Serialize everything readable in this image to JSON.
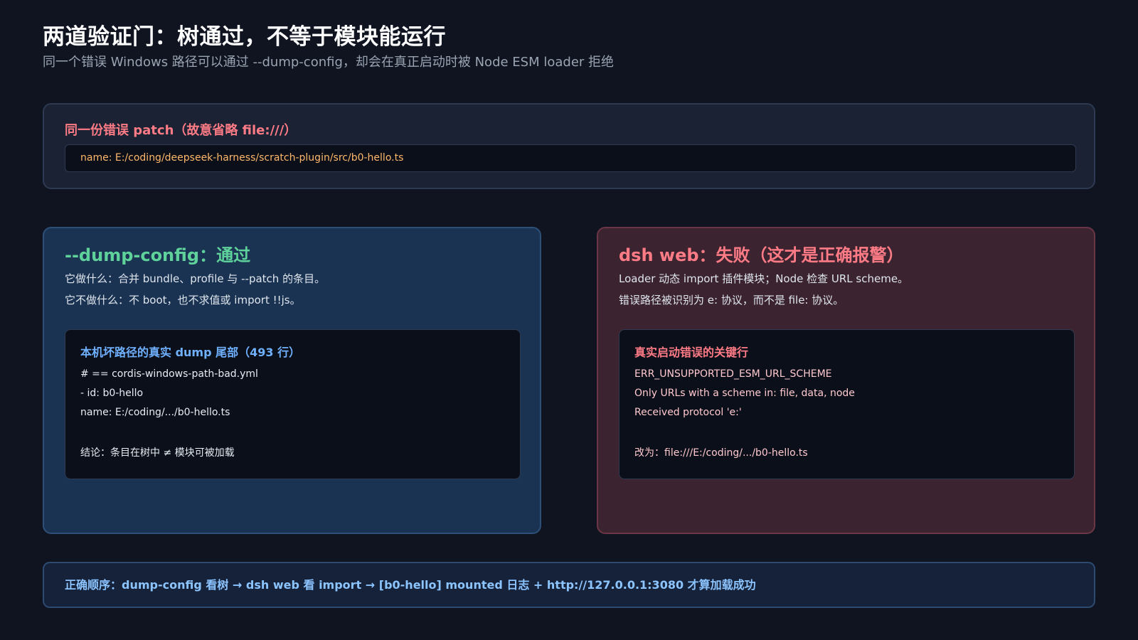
{
  "header": {
    "title": "两道验证门：树通过，不等于模块能运行",
    "subtitle": "同一个错误 Windows 路径可以通过 --dump-config，却会在真正启动时被 Node ESM loader 拒绝"
  },
  "patch": {
    "title": "同一份错误 patch（故意省略 file:///）",
    "code": "name: E:/coding/deepseek-harness/scratch-plugin/src/b0-hello.ts"
  },
  "left_panel": {
    "title": "--dump-config：通过",
    "line1": "它做什么：合并 bundle、profile 与 --patch 的条目。",
    "line2": "它不做什么：不 boot，也不求值或 import !!js。",
    "inner": {
      "title": "本机坏路径的真实 dump 尾部（493 行）",
      "lines": [
        "# == cordis-windows-path-bad.yml",
        "- id: b0-hello",
        "name: E:/coding/.../b0-hello.ts",
        "结论：条目在树中 ≠ 模块可被加载"
      ]
    },
    "accent_color": "#5ed29a"
  },
  "right_panel": {
    "title": "dsh web：失败（这才是正确报警）",
    "line1": "Loader 动态 import 插件模块；Node 检查 URL scheme。",
    "line2": "错误路径被识别为 e: 协议，而不是 file: 协议。",
    "inner": {
      "title": "真实启动错误的关键行",
      "lines": [
        "ERR_UNSUPPORTED_ESM_URL_SCHEME",
        "Only URLs with a scheme in: file, data, node",
        "Received protocol 'e:'",
        "改为：file:///E:/coding/.../b0-hello.ts"
      ]
    },
    "accent_color": "#ff7b86"
  },
  "footer": {
    "text": "正确顺序：dump-config 看树 → dsh web 看 import → [b0-hello] mounted 日志 + http://127.0.0.1:3080 才算加载成功"
  }
}
